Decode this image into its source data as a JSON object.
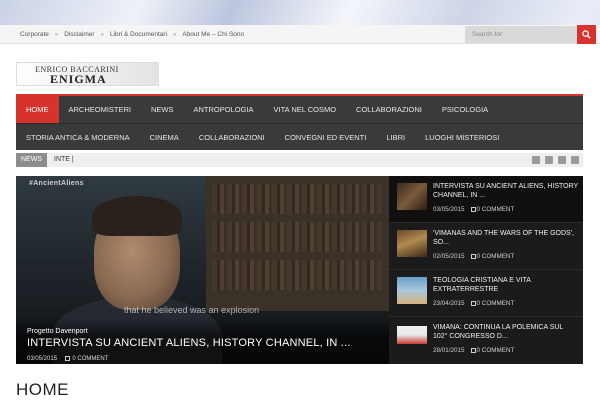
{
  "topbar": {
    "links": [
      "Corporate",
      "Disclaimer",
      "Libri & Documentari",
      "About Me – Chi Sono"
    ],
    "search_placeholder": "Search for:"
  },
  "logo": {
    "line1": "ENRICO BACCARINI",
    "line2": "ENIGMA"
  },
  "nav": {
    "row1": [
      "HOME",
      "ARCHEOMISTERI",
      "NEWS",
      "ANTROPOLOGIA",
      "VITA NEL COSMO",
      "COLLABORAZIONI",
      "PSICOLOGIA"
    ],
    "row2": [
      "STORIA ANTICA & MODERNA",
      "CINEMA",
      "COLLABORAZIONI",
      "CONVEGNI ED EVENTI",
      "LIBRI",
      "LUOGHI MISTERIOSI"
    ],
    "active": "HOME",
    "accent": "#d6332c"
  },
  "ticker": {
    "label": "NEWS",
    "text": "INTE |"
  },
  "featured": {
    "video_tag": "#AncientAliens",
    "video_subtitle": "that he believed was an explosion",
    "category": "Progetto Davenport",
    "title": "INTERVISTA SU ANCIENT ALIENS, HISTORY CHANNEL, IN ...",
    "date": "03/05/2015",
    "comments": "0 COMMENT"
  },
  "sidebar": [
    {
      "title": "INTERVISTA SU ANCIENT ALIENS, HISTORY CHANNEL, IN ...",
      "date": "03/05/2015",
      "comments": "0 COMMENT"
    },
    {
      "title": "'VIMANAS AND THE WARS OF THE GODS', SO...",
      "date": "02/05/2015",
      "comments": "0 COMMENT"
    },
    {
      "title": "TEOLOGIA CRISTIANA E VITA EXTRATERRESTRE",
      "date": "23/04/2015",
      "comments": "0 COMMENT"
    },
    {
      "title": "VIMANA: CONTINUA LA POLEMICA SUL 102° CONGRESSO D...",
      "date": "28/01/2015",
      "comments": "0 COMMENT"
    }
  ],
  "page": {
    "heading": "HOME"
  }
}
